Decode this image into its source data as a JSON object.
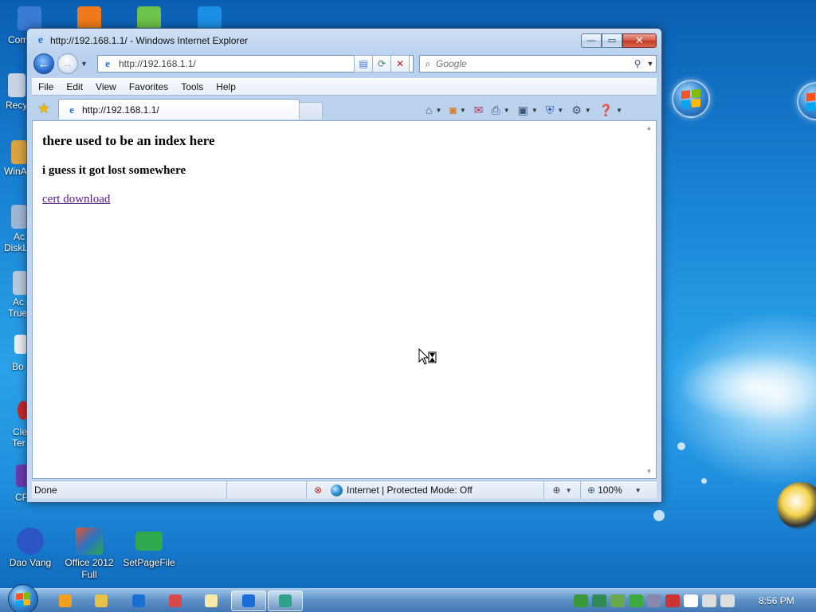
{
  "desktop": {
    "left_edge_labels": [
      "Com",
      "Recy",
      "WinA",
      "Ac",
      "DiskL",
      "Ac",
      "True",
      "Bo",
      "Cle",
      "Ter",
      "CP"
    ],
    "icons": [
      {
        "label": "Dao Vang",
        "icon": "dao-vang-icon",
        "color": "#2b56c4"
      },
      {
        "label": "Office 2012 Full",
        "icon": "office-icon",
        "color": "#e8542a"
      },
      {
        "label": "SetPageFile",
        "icon": "setpagefile-icon",
        "color": "#2fa84f"
      }
    ],
    "top_icons": [
      {
        "icon": "computer-shortcut-icon",
        "color": "#3a7bd5"
      },
      {
        "icon": "wps-office-icon",
        "color": "#f07a1a"
      },
      {
        "icon": "green-app-icon",
        "color": "#6cc24a"
      },
      {
        "icon": "teamviewer-icon",
        "color": "#1c8ee6"
      }
    ]
  },
  "window": {
    "title": "http://192.168.1.1/ - Windows Internet Explorer",
    "buttons": {
      "minimize": "—",
      "maximize": "▭",
      "close": "✕"
    }
  },
  "nav": {
    "back": "←",
    "forward": "→",
    "address": "http://192.168.1.1/",
    "search_placeholder": "Google"
  },
  "menu": [
    "File",
    "Edit",
    "View",
    "Favorites",
    "Tools",
    "Help"
  ],
  "tab": {
    "label": "http://192.168.1.1/"
  },
  "page": {
    "heading": "there used to be an index here",
    "subheading": "i guess it got lost somewhere",
    "link": "cert download"
  },
  "status": {
    "text": "Done",
    "zone": "Internet | Protected Mode: Off",
    "zoom": "100%"
  },
  "taskbar": {
    "clock": "8:56 PM",
    "apps": [
      {
        "icon": "media-player-icon",
        "color": "#f0a020"
      },
      {
        "icon": "folder-icon",
        "color": "#e8c14a"
      },
      {
        "icon": "internet-explorer-icon",
        "color": "#1a6fd6"
      },
      {
        "icon": "paint-icon",
        "color": "#d84a4a"
      },
      {
        "icon": "app-icon",
        "color": "#f4e9a6"
      },
      {
        "icon": "internet-explorer-icon",
        "color": "#1a6fd6"
      },
      {
        "icon": "network-app-icon",
        "color": "#2fa08a"
      }
    ],
    "tray": [
      {
        "icon": "network-globe-icon",
        "color": "#3a9a3a"
      },
      {
        "icon": "shield-check-icon",
        "color": "#2e8b57"
      },
      {
        "icon": "sync-icon",
        "color": "#6aa84f"
      },
      {
        "icon": "play-icon",
        "color": "#3caa3c"
      },
      {
        "icon": "tool-icon",
        "color": "#8888aa"
      },
      {
        "icon": "security-icon",
        "color": "#cc3333"
      },
      {
        "icon": "flag-icon",
        "color": "#ffffff"
      },
      {
        "icon": "monitor-icon",
        "color": "#dddddd"
      },
      {
        "icon": "volume-muted-icon",
        "color": "#dddddd"
      }
    ]
  }
}
